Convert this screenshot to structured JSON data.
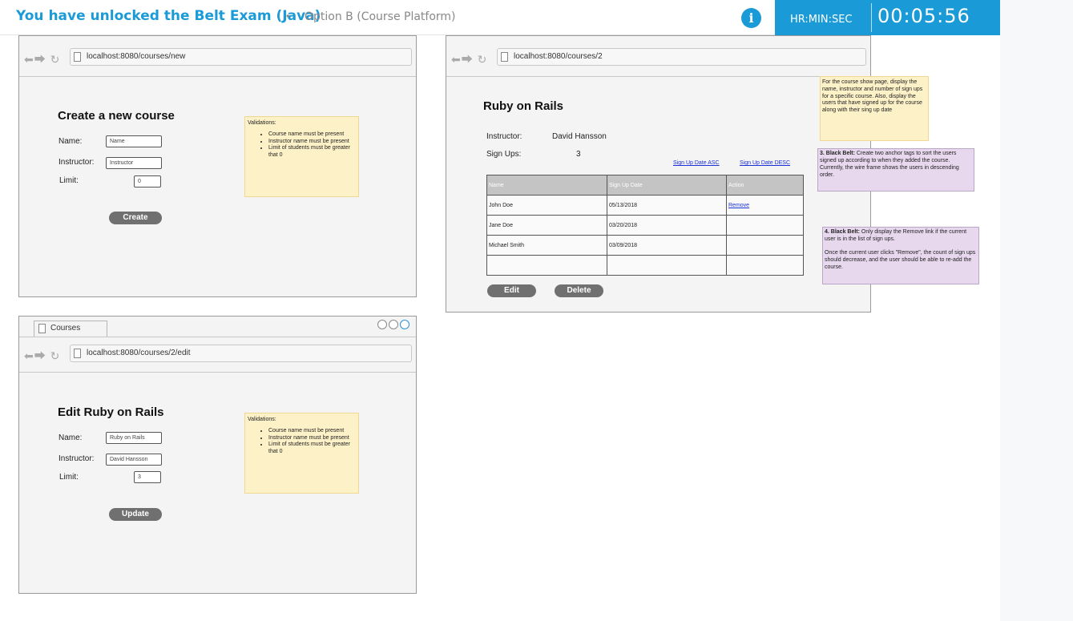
{
  "header": {
    "title": "You have unlocked the Belt Exam (Java)",
    "separator": "•",
    "subtitle": "Option B (Course Platform)",
    "info_icon": "i",
    "timer_label": "HR:MIN:SEC",
    "timer_value": "00:05:56"
  },
  "create_page": {
    "url": "localhost:8080/courses/new",
    "heading": "Create a new course",
    "name_label": "Name:",
    "name_placeholder": "Name",
    "instructor_label": "Instructor:",
    "instructor_placeholder": "Instructor",
    "limit_label": "Limit:",
    "limit_value": "0",
    "submit_label": "Create",
    "validations_title": "Validations:",
    "validations": [
      "Course name must be present",
      "Instructor name must be present",
      "Limit of students must be greater that 0"
    ]
  },
  "show_page": {
    "url": "localhost:8080/courses/2",
    "heading": "Ruby on Rails",
    "instructor_label": "Instructor:",
    "instructor_value": "David Hansson",
    "signups_label": "Sign Ups:",
    "signups_value": "3",
    "sort_asc_label": "Sign Up Date ASC",
    "sort_desc_label": "Sign Up Date DESC",
    "table": {
      "columns": [
        "Name",
        "Sign Up Date",
        "Action"
      ],
      "rows": [
        [
          "John Doe",
          "05/13/2018",
          "Remove"
        ],
        [
          "Jane Doe",
          "03/20/2018",
          ""
        ],
        [
          "Michael Smith",
          "03/09/2018",
          ""
        ],
        [
          "",
          "",
          ""
        ]
      ]
    },
    "edit_label": "Edit",
    "delete_label": "Delete",
    "note_show": "For the course show page, display the name, instructor and number of sign ups for a specific course. Also, display the users that have signed up for the course along with their sing up date",
    "note_black_belt_3_title": "3. Black Belt:",
    "note_black_belt_3": "Create two anchor tags to sort the users signed up according to when they added the course. Currently, the wire frame shows the users in descending order.",
    "note_black_belt_4_title": "4. Black Belt:",
    "note_black_belt_4": "Only display the Remove link if the current user is in the list of sign ups.",
    "note_black_belt_4b": "Once the current user clicks \"Remove\", the count of sign ups should decrease, and the user should be able to re-add the course."
  },
  "edit_page": {
    "tab_label": "Courses",
    "url": "localhost:8080/courses/2/edit",
    "heading": "Edit Ruby on Rails",
    "name_label": "Name:",
    "name_value": "Ruby on Rails",
    "instructor_label": "Instructor:",
    "instructor_value": "David Hansson",
    "limit_label": "Limit:",
    "limit_value": "3",
    "submit_label": "Update",
    "validations_title": "Validations:",
    "validations": [
      "Course name must be present",
      "Instructor name must be present",
      "Limit of students must be greater that 0"
    ]
  },
  "colors": {
    "accent": "#1a9ad6",
    "note_yellow": "#fdf1c8",
    "note_purple": "#e7d8ee",
    "button_gray": "#707070"
  }
}
